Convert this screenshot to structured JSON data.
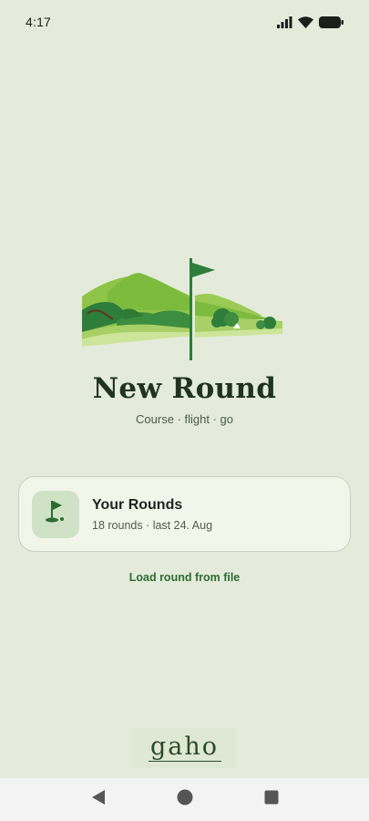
{
  "status_bar": {
    "time": "4:17"
  },
  "hero": {
    "title": "New Round",
    "subtitle": "Course · flight · go"
  },
  "rounds_card": {
    "title": "Your Rounds",
    "meta": "18 rounds · last 24. Aug"
  },
  "load_link": "Load round from file",
  "brand": {
    "wordmark": "gaho"
  },
  "colors": {
    "background": "#e4ebdb",
    "accent": "#2f6b34",
    "card": "#f2f6ea",
    "icon_tile": "#cfe2c6"
  },
  "icons": {
    "signal": "signal-icon",
    "wifi": "wifi-icon",
    "battery": "battery-icon",
    "rounds": "golf-flag-icon",
    "nav_back": "back-triangle-icon",
    "nav_home": "home-circle-icon",
    "nav_recents": "recents-square-icon"
  }
}
